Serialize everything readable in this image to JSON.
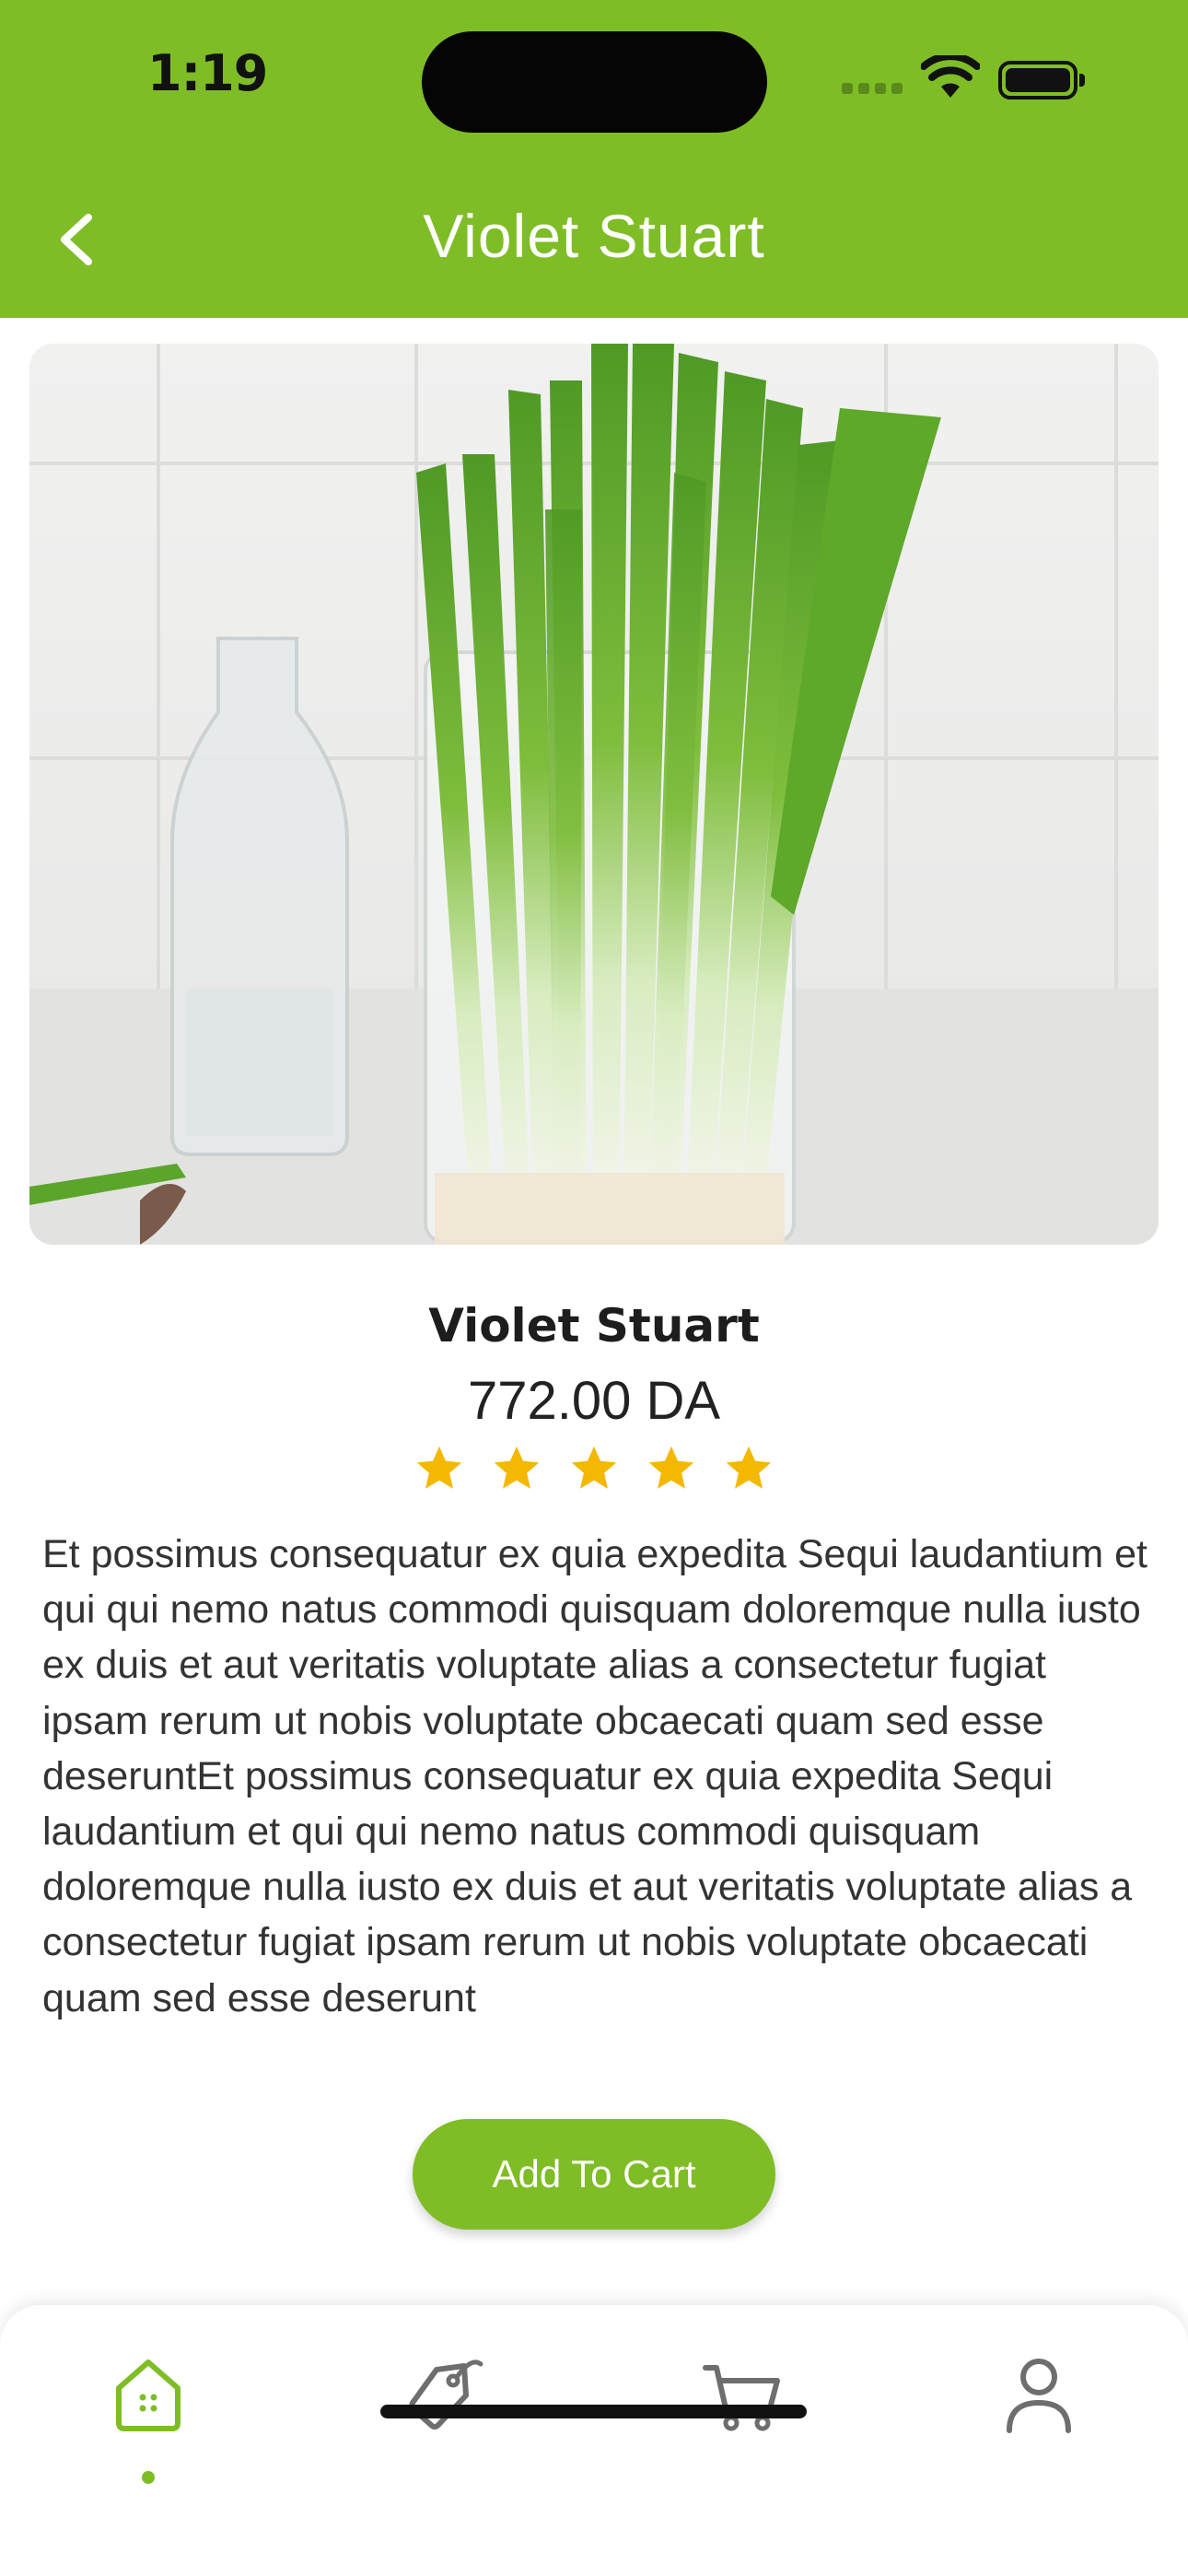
{
  "status_bar": {
    "time": "1:19"
  },
  "header": {
    "title": "Violet Stuart"
  },
  "product": {
    "name": "Violet Stuart",
    "price": "772.00 DA",
    "rating": 5,
    "rating_max": 5,
    "description": "Et possimus consequatur ex quia expedita Sequi laudantium et qui qui nemo natus commodi quisquam doloremque nulla iusto ex duis et aut veritatis voluptate alias a consectetur fugiat ipsam rerum ut nobis voluptate obcaecati quam sed esse deseruntEt possimus consequatur ex quia expedita Sequi laudantium et qui qui nemo natus commodi quisquam doloremque nulla iusto ex duis et aut veritatis voluptate alias a consectetur fugiat ipsam rerum ut nobis voluptate obcaecati quam sed esse deserunt"
  },
  "actions": {
    "add_to_cart": "Add To Cart"
  },
  "bottom_nav": {
    "items": [
      {
        "icon": "home-icon",
        "active": true
      },
      {
        "icon": "tag-icon",
        "active": false
      },
      {
        "icon": "cart-icon",
        "active": false
      },
      {
        "icon": "profile-icon",
        "active": false
      }
    ]
  },
  "colors": {
    "accent": "#7fbd27",
    "star": "#f5b800",
    "background": "#ffffff"
  }
}
